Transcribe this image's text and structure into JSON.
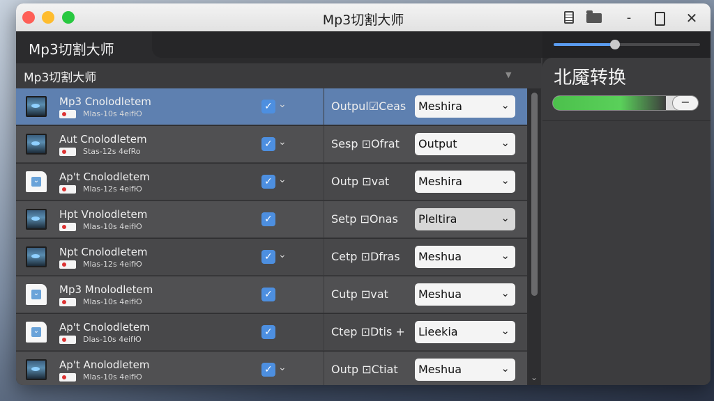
{
  "window": {
    "title": "Mp3切割大师"
  },
  "app": {
    "title": "Mp3切割大师",
    "subtitle": "Mp3切割大师",
    "subtitle_arrow": "▼"
  },
  "toolbar_icons": {
    "doc": "document-icon",
    "folder": "folder-icon",
    "minimize": "-",
    "maximize": "maximize-icon",
    "close": "✕"
  },
  "rows": [
    {
      "thumb": "image",
      "name": "Mp3 Cnolodletem",
      "meta": "Mlas-10s 4eifЮ",
      "checked": true,
      "chevron": "⌄",
      "output_label": "Outpul☑Ceas",
      "select": "Meshira",
      "selected": true
    },
    {
      "thumb": "image",
      "name": "Aut Cnolodletem",
      "meta": "Stas-12s 4efRo",
      "checked": true,
      "chevron": "⌄",
      "output_label": "Sesp ⊡Ofrat",
      "select": "Output",
      "selected": false
    },
    {
      "thumb": "doc",
      "name": "Ap't Cnolodletem",
      "meta": "Mlas-12s 4eifЮ",
      "checked": true,
      "chevron": "⌄",
      "output_label": "Outp ⊡vat",
      "select": "Meshira",
      "selected": false
    },
    {
      "thumb": "image",
      "name": "Hpt Vnolodletem",
      "meta": "Mlas-10s 4eifЮ",
      "checked": true,
      "chevron": "",
      "output_label": "Setp ⊡Onas",
      "select": "Pleltira",
      "selected": false
    },
    {
      "thumb": "image",
      "name": "Npt Cnolodletem",
      "meta": "Mlas-12s 4eifЮ",
      "checked": true,
      "chevron": "⌄",
      "output_label": "Cetp ⊡Dfras",
      "select": "Meshua",
      "selected": false
    },
    {
      "thumb": "doc",
      "name": "Mp3 Mnolodletem",
      "meta": "Mlas-10s 4eifЮ",
      "checked": true,
      "chevron": "",
      "output_label": "Cutp ⊡vat",
      "select": "Meshua",
      "selected": false
    },
    {
      "thumb": "doc",
      "name": "Ap't Cnolodletem",
      "meta": "Dlas-10s 4eifЮ",
      "checked": true,
      "chevron": "",
      "output_label": "Ctep ⊡Dtis +",
      "select": "Lieekia",
      "selected": false
    },
    {
      "thumb": "image",
      "name": "Ap't Anolodletem",
      "meta": "Mlas-10s 4eifЮ",
      "checked": true,
      "chevron": "⌄",
      "output_label": "Outp ⊡Ctiat",
      "select": "Meshua",
      "selected": false
    }
  ],
  "right_panel": {
    "title": "北魇转换",
    "progress_fraction": 0.78,
    "progress_button": "−",
    "top_slider_fraction": 0.42
  },
  "colors": {
    "selected_row": "#5e80b0",
    "checkbox": "#4d8fe0",
    "progress": "#4cc04c"
  }
}
